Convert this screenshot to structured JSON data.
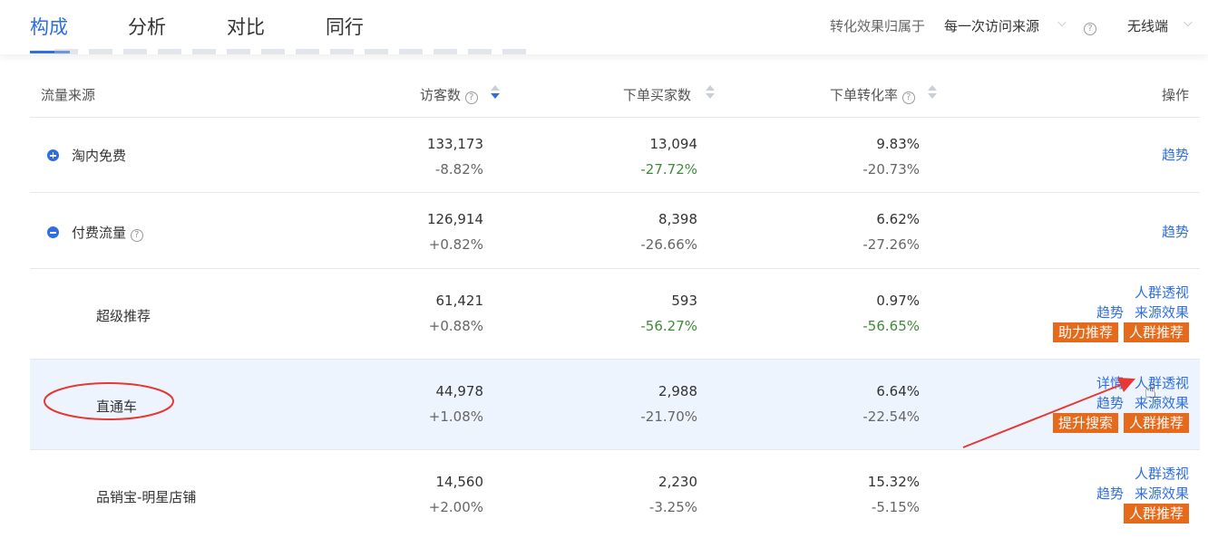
{
  "tabs": [
    {
      "label": "构成",
      "active": true
    },
    {
      "label": "分析",
      "active": false
    },
    {
      "label": "对比",
      "active": false
    },
    {
      "label": "同行",
      "active": false
    }
  ],
  "attribution": {
    "label": "转化效果归属于",
    "value": "每一次访问来源"
  },
  "device": {
    "value": "无线端"
  },
  "help_glyph": "?",
  "table": {
    "headers": {
      "source": "流量来源",
      "visitors": "访客数",
      "buyers": "下单买家数",
      "conversion": "下单转化率",
      "ops": "操作"
    },
    "rows": [
      {
        "name": "淘内免费",
        "level": 0,
        "toggle": "expand",
        "visitors": "133,173",
        "visitors_change": "-8.82%",
        "buyers": "13,094",
        "buyers_change": "-27.72%",
        "conversion": "9.83%",
        "conversion_change": "-20.73%",
        "links_line1": [],
        "links_line2": [
          "趋势"
        ],
        "buttons": []
      },
      {
        "name": "付费流量",
        "level": 0,
        "toggle": "collapse",
        "help": true,
        "visitors": "126,914",
        "visitors_change": "+0.82%",
        "buyers": "8,398",
        "buyers_change": "-26.66%",
        "conversion": "6.62%",
        "conversion_change": "-27.26%",
        "links_line1": [],
        "links_line2": [
          "趋势"
        ],
        "buttons": []
      },
      {
        "name": "超级推荐",
        "level": 1,
        "visitors": "61,421",
        "visitors_change": "+0.88%",
        "buyers": "593",
        "buyers_change": "-56.27%",
        "conversion": "0.97%",
        "conversion_change": "-56.65%",
        "links_line1": [
          "人群透视"
        ],
        "links_line2": [
          "趋势",
          "来源效果"
        ],
        "buttons": [
          "助力推荐",
          "人群推荐"
        ]
      },
      {
        "name": "直通车",
        "level": 1,
        "highlight": true,
        "visitors": "44,978",
        "visitors_change": "+1.08%",
        "buyers": "2,988",
        "buyers_change": "-21.70%",
        "conversion": "6.64%",
        "conversion_change": "-22.54%",
        "links_line1": [
          "详情",
          "人群透视"
        ],
        "links_line2": [
          "趋势",
          "来源效果"
        ],
        "buttons": [
          "提升搜索",
          "人群推荐"
        ]
      },
      {
        "name": "品销宝-明星店铺",
        "level": 1,
        "visitors": "14,560",
        "visitors_change": "+2.00%",
        "buyers": "2,230",
        "buyers_change": "-3.25%",
        "conversion": "15.32%",
        "conversion_change": "-5.15%",
        "links_line1": [
          "人群透视"
        ],
        "links_line2": [
          "趋势",
          "来源效果"
        ],
        "buttons": [
          "人群推荐"
        ]
      }
    ]
  },
  "colors": {
    "accent": "#2f6ee0",
    "orange": "#e56a1c",
    "negative": "#3f8a3a",
    "annotation": "#e53935"
  }
}
